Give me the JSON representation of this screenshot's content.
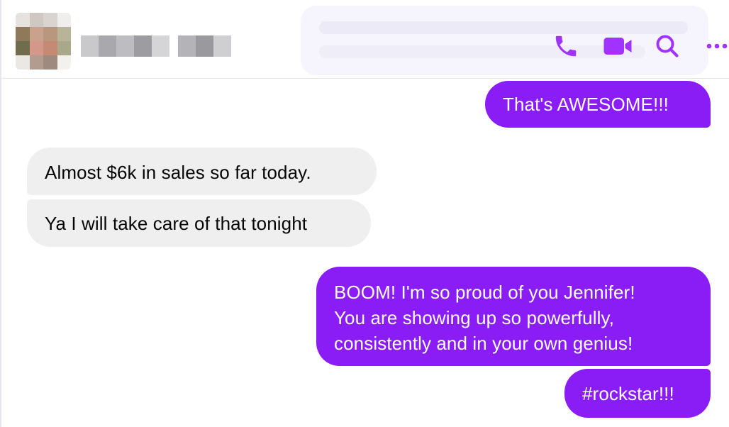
{
  "header": {
    "contact_name": "",
    "actions": [
      {
        "name": "phone-icon",
        "label": "Audio call"
      },
      {
        "name": "video-camera-icon",
        "label": "Video call"
      },
      {
        "name": "search-icon",
        "label": "Search in conversation"
      },
      {
        "name": "more-options-icon",
        "label": "Conversation information"
      }
    ],
    "accent_color": "#a033ff"
  },
  "messages": [
    {
      "direction": "out",
      "text": "That's AWESOME!!!"
    },
    {
      "direction": "in",
      "text": "Almost $6k in sales so far today."
    },
    {
      "direction": "in",
      "text": "Ya I will take care of that tonight"
    },
    {
      "direction": "out",
      "lines": [
        "BOOM! I'm so proud of you Jennifer!",
        "You are showing up so powerfully,",
        "consistently and in your own genius!"
      ]
    },
    {
      "direction": "out",
      "text": "#rockstar!!!"
    }
  ],
  "colors": {
    "outgoing_bubble": "#8a1cf5",
    "incoming_bubble": "#efefef",
    "incoming_text": "#050505",
    "outgoing_text": "#ffffff"
  }
}
